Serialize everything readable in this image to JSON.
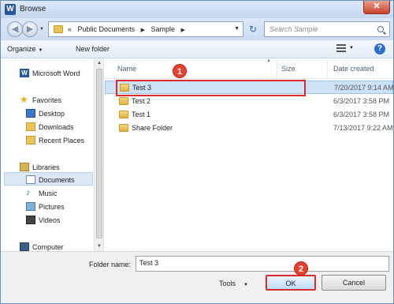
{
  "window": {
    "title": "Browse",
    "app_icon": "W",
    "close_glyph": "✕"
  },
  "address": {
    "prefix": "«",
    "segments": [
      "Public Documents",
      "Sample"
    ],
    "search_placeholder": "Search Sample"
  },
  "toolbar": {
    "organize": "Organize",
    "new_folder": "New folder",
    "help": "?"
  },
  "nav": {
    "items": [
      {
        "label": "Microsoft Word",
        "icon": "word-icon"
      },
      {
        "label": "Favorites",
        "icon": "star-icon"
      },
      {
        "label": "Desktop",
        "icon": "desktop-icon"
      },
      {
        "label": "Downloads",
        "icon": "downloads-icon"
      },
      {
        "label": "Recent Places",
        "icon": "recent-places-icon"
      },
      {
        "label": "Libraries",
        "icon": "libraries-icon"
      },
      {
        "label": "Documents",
        "icon": "documents-icon"
      },
      {
        "label": "Music",
        "icon": "music-icon"
      },
      {
        "label": "Pictures",
        "icon": "pictures-icon"
      },
      {
        "label": "Videos",
        "icon": "videos-icon"
      },
      {
        "label": "Computer",
        "icon": "computer-icon"
      }
    ],
    "selected": "Documents"
  },
  "files": {
    "columns": [
      "Name",
      "Size",
      "Date created"
    ],
    "rows": [
      {
        "name": "Test 3",
        "date": "7/20/2017 9:14 AM",
        "selected": true
      },
      {
        "name": "Test 2",
        "date": "6/3/2017 3:58 PM",
        "selected": false
      },
      {
        "name": "Test 1",
        "date": "6/3/2017 3:58 PM",
        "selected": false
      },
      {
        "name": "Share Folder",
        "date": "7/13/2017 9:22 AM",
        "selected": false
      }
    ]
  },
  "annotations": {
    "step1": "1",
    "step2": "2"
  },
  "bottom": {
    "folder_name_label": "Folder name:",
    "folder_name_value": "Test 3",
    "tools": "Tools",
    "ok": "OK",
    "cancel": "Cancel"
  },
  "colors": {
    "highlight_red": "#d92b2b",
    "selection_blue": "#cde1f7",
    "badge_red": "#e8402f"
  }
}
